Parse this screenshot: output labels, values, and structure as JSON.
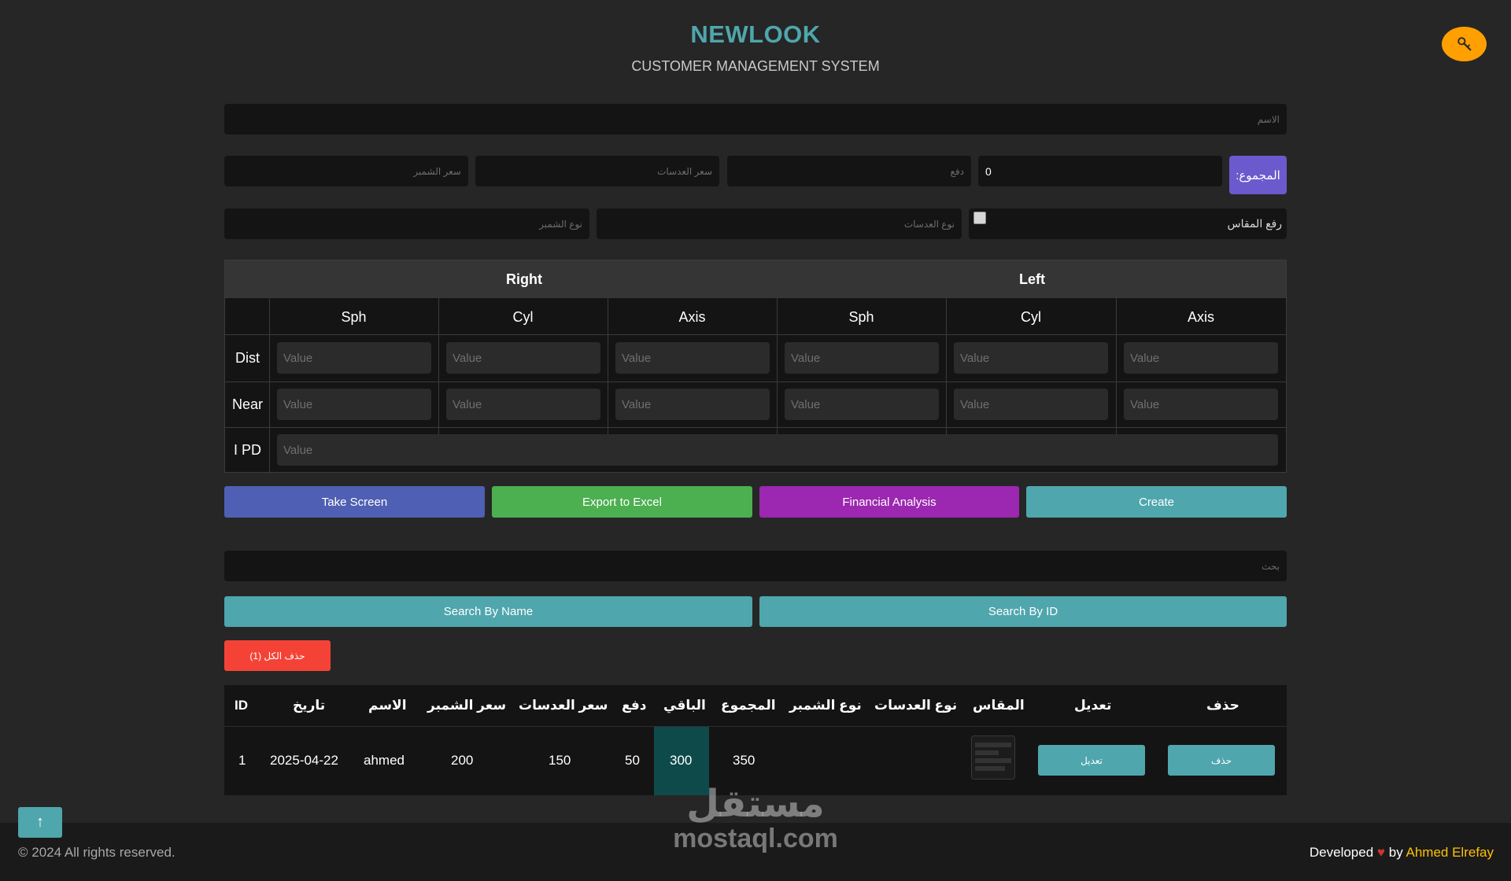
{
  "header": {
    "brand": "NEWLOOK",
    "subtitle": "CUSTOMER MANAGEMENT SYSTEM"
  },
  "form": {
    "name_placeholder": "الاسم",
    "frame_price_placeholder": "سعر الشمبر",
    "lens_price_placeholder": "سعر العدسات",
    "payment_placeholder": "دفع",
    "total_value": "0",
    "total_label": "المجموع:",
    "frame_type_placeholder": "نوع الشمبر",
    "lens_type_placeholder": "نوع العدسات",
    "upload_label": "رفع المقاس"
  },
  "rx": {
    "right": "Right",
    "left": "Left",
    "cols": [
      "Sph",
      "Cyl",
      "Axis",
      "Sph",
      "Cyl",
      "Axis"
    ],
    "rows": [
      "Dist",
      "Near"
    ],
    "ipd": "I PD",
    "placeholder": "Value"
  },
  "actions": {
    "take_screen": "Take Screen",
    "export_excel": "Export to Excel",
    "financial": "Financial Analysis",
    "create": "Create"
  },
  "search": {
    "placeholder": "بحث",
    "by_name": "Search By Name",
    "by_id": "Search By ID",
    "delete_all": "حذف الكل (1)"
  },
  "table": {
    "headers": {
      "id": "ID",
      "date": "تاريخ",
      "name": "الاسم",
      "frame_price": "سعر الشمبر",
      "lens_price": "سعر العدسات",
      "payment": "دفع",
      "remaining": "الباقي",
      "total": "المجموع",
      "frame_type": "نوع الشمبر",
      "lens_type": "نوع العدسات",
      "measure": "المقاس",
      "edit": "تعديل",
      "delete": "حذف"
    },
    "rows": [
      {
        "id": "1",
        "date": "2025-04-22",
        "name": "ahmed",
        "frame_price": "200",
        "lens_price": "150",
        "payment": "50",
        "remaining": "300",
        "total": "350",
        "frame_type": "",
        "lens_type": "",
        "edit_label": "تعديل",
        "delete_label": "حذف"
      }
    ]
  },
  "footer": {
    "copyright": "© 2024 All rights reserved.",
    "developed": "Developed",
    "by": "by",
    "author": "Ahmed Elrefay",
    "up_arrow": "↑"
  },
  "watermark": {
    "arabic": "مستقل",
    "latin": "mostaql.com"
  },
  "colors": {
    "brand": "#4fa6ad",
    "key_button": "#ffa000",
    "total_label": "#6a5acd",
    "take_screen": "#4f5fb3",
    "export_excel": "#4caf50",
    "financial": "#9c27b0",
    "create": "#4fa6ad",
    "delete_all": "#f44336"
  },
  "icons": {
    "key_button": "key-icon",
    "heart": "heart-icon",
    "up": "arrow-up-icon"
  }
}
